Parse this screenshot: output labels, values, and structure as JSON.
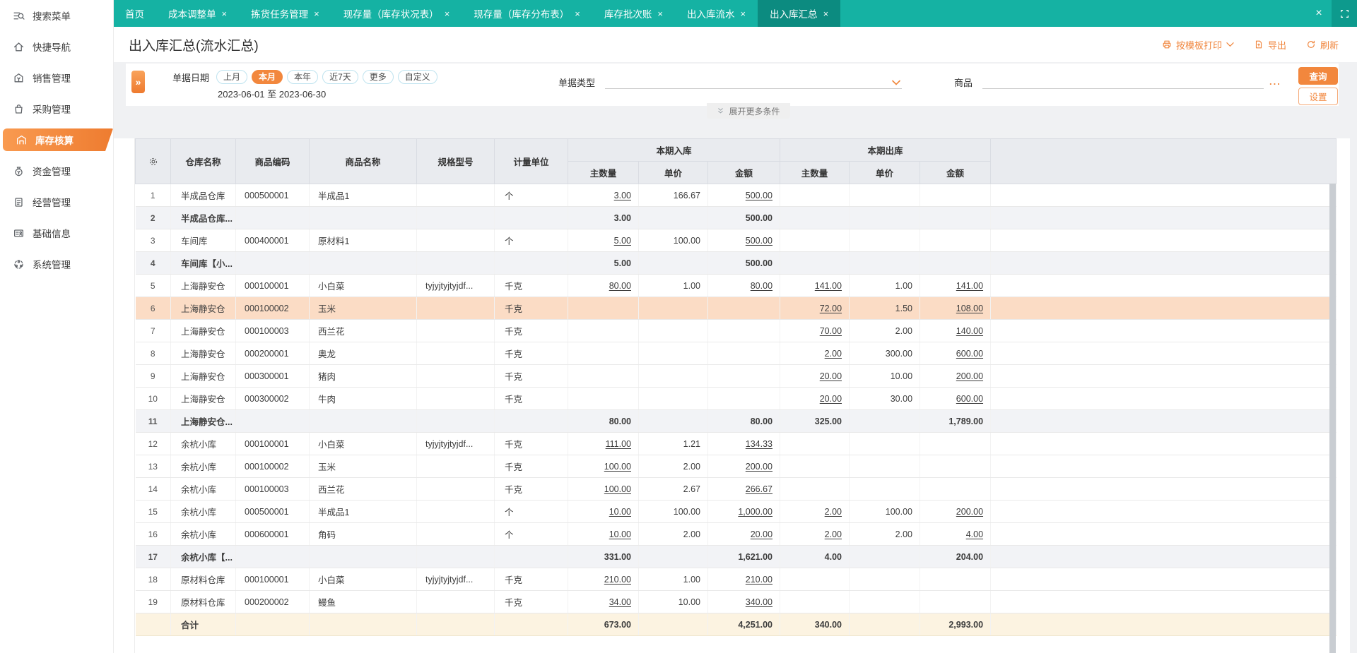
{
  "tabs": [
    {
      "label": "首页",
      "closable": false,
      "active": false
    },
    {
      "label": "成本调整单",
      "closable": true,
      "active": false
    },
    {
      "label": "拣货任务管理",
      "closable": true,
      "active": false
    },
    {
      "label": "现存量（库存状况表）",
      "closable": true,
      "active": false
    },
    {
      "label": "现存量（库存分布表）",
      "closable": true,
      "active": false
    },
    {
      "label": "库存批次账",
      "closable": true,
      "active": false
    },
    {
      "label": "出入库流水",
      "closable": true,
      "active": false
    },
    {
      "label": "出入库汇总",
      "closable": true,
      "active": true
    }
  ],
  "sidebar": {
    "items": [
      {
        "label": "搜索菜单",
        "icon": "search-menu-icon",
        "active": false
      },
      {
        "label": "快捷导航",
        "icon": "quick-nav-icon",
        "active": false
      },
      {
        "label": "销售管理",
        "icon": "sales-icon",
        "active": false
      },
      {
        "label": "采购管理",
        "icon": "purchase-icon",
        "active": false
      },
      {
        "label": "库存核算",
        "icon": "inventory-icon",
        "active": true
      },
      {
        "label": "资金管理",
        "icon": "funds-icon",
        "active": false
      },
      {
        "label": "经营管理",
        "icon": "operations-icon",
        "active": false
      },
      {
        "label": "基础信息",
        "icon": "base-info-icon",
        "active": false
      },
      {
        "label": "系统管理",
        "icon": "system-icon",
        "active": false
      }
    ]
  },
  "page": {
    "title": "出入库汇总(流水汇总)"
  },
  "header_actions": {
    "print": "按模板打印",
    "export": "导出",
    "refresh": "刷新"
  },
  "filters": {
    "date_label": "单据日期",
    "date_pills": [
      "上月",
      "本月",
      "本年",
      "近7天",
      "更多",
      "自定义"
    ],
    "active_pill": "本月",
    "date_range": "2023-06-01 至 2023-06-30",
    "doc_type_label": "单据类型",
    "product_label": "商品",
    "product_more": "...",
    "query_button": "查询",
    "settings_button": "设置",
    "expand_more": "展开更多条件"
  },
  "table": {
    "col_warehouse": "仓库名称",
    "col_code": "商品编码",
    "col_name": "商品名称",
    "col_spec": "规格型号",
    "col_unit": "计量单位",
    "group_in": "本期入库",
    "group_out": "本期出库",
    "col_qty": "主数量",
    "col_price": "单价",
    "col_amount": "金额",
    "rows": [
      {
        "n": "1",
        "wh": "半成品仓库",
        "code": "000500001",
        "name": "半成品1",
        "spec": "",
        "unit": "个",
        "iq": "3.00",
        "ip": "166.67",
        "ia": "500.00",
        "oq": "",
        "op": "",
        "oa": "",
        "t": "data"
      },
      {
        "n": "2",
        "wh": "半成品仓库...",
        "code": "",
        "name": "",
        "spec": "",
        "unit": "",
        "iq": "3.00",
        "ip": "",
        "ia": "500.00",
        "oq": "",
        "op": "",
        "oa": "",
        "t": "subtotal"
      },
      {
        "n": "3",
        "wh": "车间库",
        "code": "000400001",
        "name": "原材料1",
        "spec": "",
        "unit": "个",
        "iq": "5.00",
        "ip": "100.00",
        "ia": "500.00",
        "oq": "",
        "op": "",
        "oa": "",
        "t": "data"
      },
      {
        "n": "4",
        "wh": "车间库【小...",
        "code": "",
        "name": "",
        "spec": "",
        "unit": "",
        "iq": "5.00",
        "ip": "",
        "ia": "500.00",
        "oq": "",
        "op": "",
        "oa": "",
        "t": "subtotal"
      },
      {
        "n": "5",
        "wh": "上海静安仓",
        "code": "000100001",
        "name": "小白菜",
        "spec": "tyjyjtyjtyjdf...",
        "unit": "千克",
        "iq": "80.00",
        "ip": "1.00",
        "ia": "80.00",
        "oq": "141.00",
        "op": "1.00",
        "oa": "141.00",
        "t": "data"
      },
      {
        "n": "6",
        "wh": "上海静安仓",
        "code": "000100002",
        "name": "玉米",
        "spec": "",
        "unit": "千克",
        "iq": "",
        "ip": "",
        "ia": "",
        "oq": "72.00",
        "op": "1.50",
        "oa": "108.00",
        "t": "selected"
      },
      {
        "n": "7",
        "wh": "上海静安仓",
        "code": "000100003",
        "name": "西兰花",
        "spec": "",
        "unit": "千克",
        "iq": "",
        "ip": "",
        "ia": "",
        "oq": "70.00",
        "op": "2.00",
        "oa": "140.00",
        "t": "data"
      },
      {
        "n": "8",
        "wh": "上海静安仓",
        "code": "000200001",
        "name": "奥龙",
        "spec": "",
        "unit": "千克",
        "iq": "",
        "ip": "",
        "ia": "",
        "oq": "2.00",
        "op": "300.00",
        "oa": "600.00",
        "t": "data"
      },
      {
        "n": "9",
        "wh": "上海静安仓",
        "code": "000300001",
        "name": "猪肉",
        "spec": "",
        "unit": "千克",
        "iq": "",
        "ip": "",
        "ia": "",
        "oq": "20.00",
        "op": "10.00",
        "oa": "200.00",
        "t": "data"
      },
      {
        "n": "10",
        "wh": "上海静安仓",
        "code": "000300002",
        "name": "牛肉",
        "spec": "",
        "unit": "千克",
        "iq": "",
        "ip": "",
        "ia": "",
        "oq": "20.00",
        "op": "30.00",
        "oa": "600.00",
        "t": "data"
      },
      {
        "n": "11",
        "wh": "上海静安仓...",
        "code": "",
        "name": "",
        "spec": "",
        "unit": "",
        "iq": "80.00",
        "ip": "",
        "ia": "80.00",
        "oq": "325.00",
        "op": "",
        "oa": "1,789.00",
        "t": "subtotal"
      },
      {
        "n": "12",
        "wh": "余杭小库",
        "code": "000100001",
        "name": "小白菜",
        "spec": "tyjyjtyjtyjdf...",
        "unit": "千克",
        "iq": "111.00",
        "ip": "1.21",
        "ia": "134.33",
        "oq": "",
        "op": "",
        "oa": "",
        "t": "data"
      },
      {
        "n": "13",
        "wh": "余杭小库",
        "code": "000100002",
        "name": "玉米",
        "spec": "",
        "unit": "千克",
        "iq": "100.00",
        "ip": "2.00",
        "ia": "200.00",
        "oq": "",
        "op": "",
        "oa": "",
        "t": "data"
      },
      {
        "n": "14",
        "wh": "余杭小库",
        "code": "000100003",
        "name": "西兰花",
        "spec": "",
        "unit": "千克",
        "iq": "100.00",
        "ip": "2.67",
        "ia": "266.67",
        "oq": "",
        "op": "",
        "oa": "",
        "t": "data"
      },
      {
        "n": "15",
        "wh": "余杭小库",
        "code": "000500001",
        "name": "半成品1",
        "spec": "",
        "unit": "个",
        "iq": "10.00",
        "ip": "100.00",
        "ia": "1,000.00",
        "oq": "2.00",
        "op": "100.00",
        "oa": "200.00",
        "t": "data"
      },
      {
        "n": "16",
        "wh": "余杭小库",
        "code": "000600001",
        "name": "角码",
        "spec": "",
        "unit": "个",
        "iq": "10.00",
        "ip": "2.00",
        "ia": "20.00",
        "oq": "2.00",
        "op": "2.00",
        "oa": "4.00",
        "t": "data"
      },
      {
        "n": "17",
        "wh": "余杭小库【...",
        "code": "",
        "name": "",
        "spec": "",
        "unit": "",
        "iq": "331.00",
        "ip": "",
        "ia": "1,621.00",
        "oq": "4.00",
        "op": "",
        "oa": "204.00",
        "t": "subtotal"
      },
      {
        "n": "18",
        "wh": "原材料仓库",
        "code": "000100001",
        "name": "小白菜",
        "spec": "tyjyjtyjtyjdf...",
        "unit": "千克",
        "iq": "210.00",
        "ip": "1.00",
        "ia": "210.00",
        "oq": "",
        "op": "",
        "oa": "",
        "t": "data"
      },
      {
        "n": "19",
        "wh": "原材料仓库",
        "code": "000200002",
        "name": "鳗鱼",
        "spec": "",
        "unit": "千克",
        "iq": "34.00",
        "ip": "10.00",
        "ia": "340.00",
        "oq": "",
        "op": "",
        "oa": "",
        "t": "data"
      },
      {
        "n": "",
        "wh": "合计",
        "code": "",
        "name": "",
        "spec": "",
        "unit": "",
        "iq": "673.00",
        "ip": "",
        "ia": "4,251.00",
        "oq": "340.00",
        "op": "",
        "oa": "2,993.00",
        "t": "total"
      }
    ]
  },
  "colors": {
    "teal": "#15b2a3",
    "teal_dark": "#0c8b80",
    "orange": "#f2873d",
    "selected_row": "#fbdcc5",
    "subtotal_row": "#f2f3f6",
    "total_row": "#fcf3e1"
  }
}
